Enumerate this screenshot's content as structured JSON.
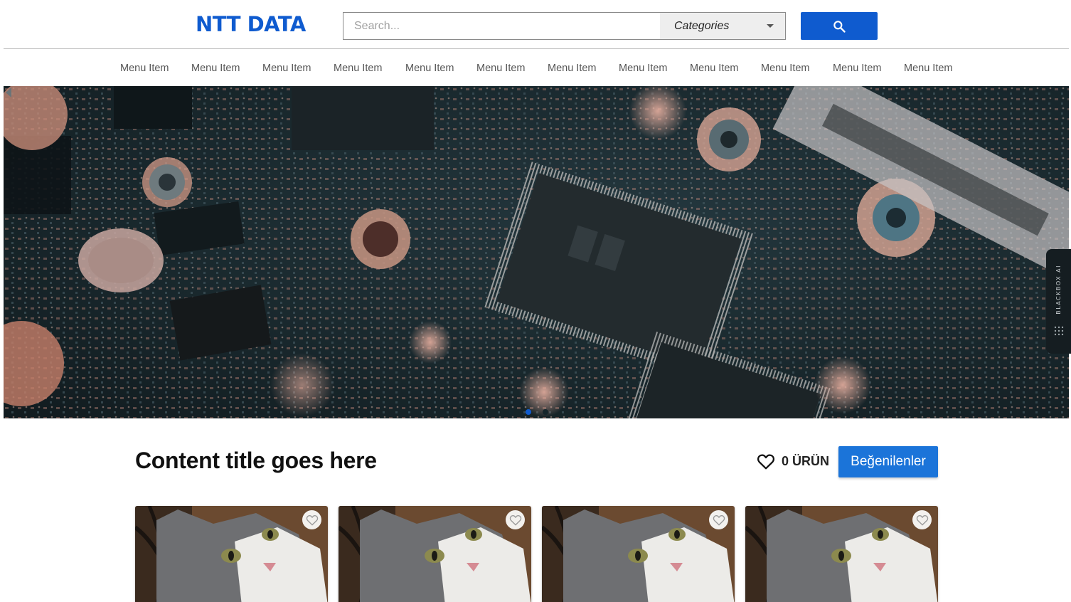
{
  "header": {
    "logo": "NTT DATA",
    "search": {
      "placeholder": "Search...",
      "value": ""
    },
    "category_select": "Categories",
    "search_button_icon": "search-icon"
  },
  "nav": {
    "items": [
      {
        "label": "Menu Item"
      },
      {
        "label": "Menu Item"
      },
      {
        "label": "Menu Item"
      },
      {
        "label": "Menu Item"
      },
      {
        "label": "Menu Item"
      },
      {
        "label": "Menu Item"
      },
      {
        "label": "Menu Item"
      },
      {
        "label": "Menu Item"
      },
      {
        "label": "Menu Item"
      },
      {
        "label": "Menu Item"
      },
      {
        "label": "Menu Item"
      },
      {
        "label": "Menu Item"
      }
    ]
  },
  "hero": {
    "slides": 3,
    "active_slide": 1,
    "side_tab_label": "BLACKBOX AI"
  },
  "content": {
    "title": "Content title goes here",
    "likes_icon": "heart-outline-icon",
    "likes_count": "0 ÜRÜN",
    "favorites_button": "Beğenilenler"
  },
  "products": [
    {
      "icon": "heart-outline-icon"
    },
    {
      "icon": "heart-outline-icon"
    },
    {
      "icon": "heart-outline-icon"
    },
    {
      "icon": "heart-outline-icon"
    }
  ],
  "colors": {
    "brand": "#0f5bcf",
    "button": "#1b74d9",
    "nav_text": "#555555"
  }
}
